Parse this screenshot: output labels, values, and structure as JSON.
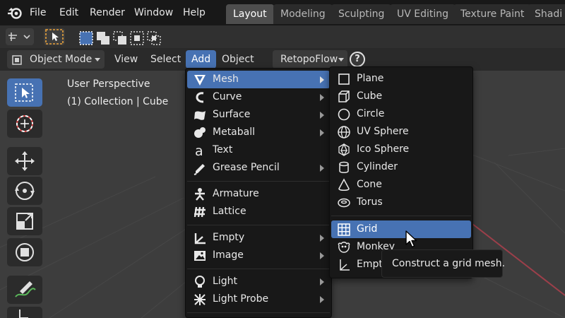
{
  "menubar": {
    "items": [
      "File",
      "Edit",
      "Render",
      "Window",
      "Help"
    ]
  },
  "workspace_tabs": [
    "Layout",
    "Modeling",
    "Sculpting",
    "UV Editing",
    "Texture Paint",
    "Shadi"
  ],
  "active_workspace": "Layout",
  "header": {
    "mode": "Object Mode",
    "view": "View",
    "select": "Select",
    "add": "Add",
    "object": "Object",
    "addon": "RetopoFlow",
    "help": "?"
  },
  "viewport": {
    "perspective": "User Perspective",
    "collection": "(1) Collection | Cube"
  },
  "add_menu": {
    "items": [
      {
        "label": "Mesh",
        "icon": "mesh-icon",
        "submenu": true
      },
      {
        "label": "Curve",
        "icon": "curve-icon",
        "submenu": true
      },
      {
        "label": "Surface",
        "icon": "surface-icon",
        "submenu": true
      },
      {
        "label": "Metaball",
        "icon": "metaball-icon",
        "submenu": true
      },
      {
        "label": "Text",
        "icon": "text-icon",
        "submenu": false
      },
      {
        "label": "Grease Pencil",
        "icon": "grease-pencil-icon",
        "submenu": true
      },
      {
        "label": "Armature",
        "icon": "armature-icon",
        "submenu": false
      },
      {
        "label": "Lattice",
        "icon": "lattice-icon",
        "submenu": false
      },
      {
        "label": "Empty",
        "icon": "empty-icon",
        "submenu": true
      },
      {
        "label": "Image",
        "icon": "image-icon",
        "submenu": true
      },
      {
        "label": "Light",
        "icon": "light-icon",
        "submenu": true
      },
      {
        "label": "Light Probe",
        "icon": "light-probe-icon",
        "submenu": true
      }
    ]
  },
  "mesh_menu": {
    "items": [
      {
        "label": "Plane",
        "icon": "plane-icon"
      },
      {
        "label": "Cube",
        "icon": "cube-icon"
      },
      {
        "label": "Circle",
        "icon": "circle-icon"
      },
      {
        "label": "UV Sphere",
        "icon": "uv-sphere-icon"
      },
      {
        "label": "Ico Sphere",
        "icon": "ico-sphere-icon"
      },
      {
        "label": "Cylinder",
        "icon": "cylinder-icon"
      },
      {
        "label": "Cone",
        "icon": "cone-icon"
      },
      {
        "label": "Torus",
        "icon": "torus-icon"
      },
      {
        "label": "Grid",
        "icon": "grid-icon"
      },
      {
        "label": "Monkey",
        "icon": "monkey-icon"
      },
      {
        "label": "Empty",
        "icon": "empty-mesh-icon"
      }
    ],
    "highlighted": "Grid"
  },
  "tooltip": {
    "text": "Construct a grid mesh."
  },
  "colors": {
    "accent": "#4772b3",
    "menu_bg": "#181818",
    "topbar_bg": "#181818",
    "viewport_bg": "#3d3d3d",
    "select_tool_orange": "#e9a23b"
  }
}
